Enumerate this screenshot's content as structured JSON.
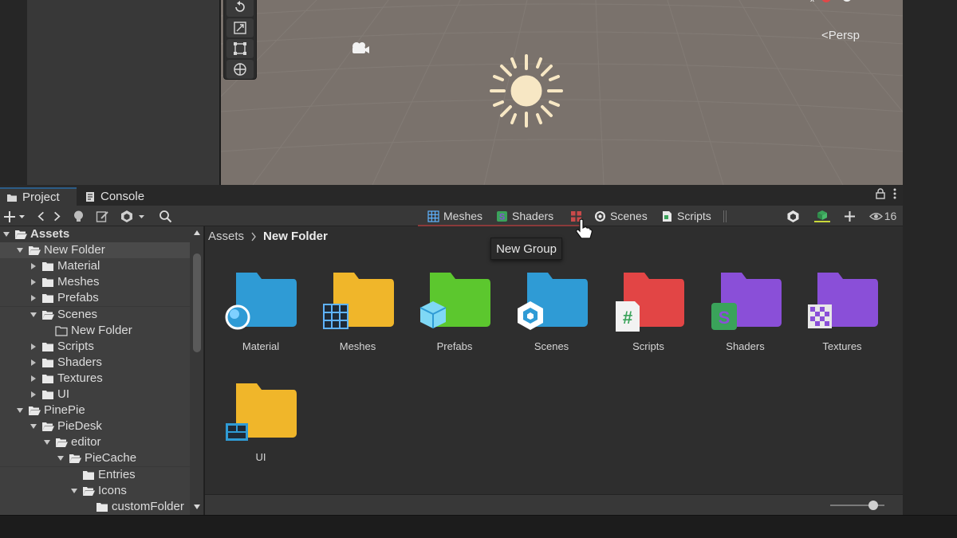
{
  "scene": {
    "persp_label": "Persp"
  },
  "tabs": [
    {
      "label": "Project",
      "icon": "folder-icon"
    },
    {
      "label": "Console",
      "icon": "console-icon"
    }
  ],
  "toolbar": {
    "hidden_count": "16"
  },
  "filters": [
    {
      "label": "Meshes",
      "icon": "grid-icon"
    },
    {
      "label": "Shaders",
      "icon": "shader-icon"
    },
    {
      "label": "",
      "icon": "group-icon"
    },
    {
      "label": "Scenes",
      "icon": "unity-icon"
    },
    {
      "label": "Scripts",
      "icon": "script-icon"
    }
  ],
  "tooltip": "New Group",
  "tree": [
    {
      "label": "Assets",
      "depth": 0,
      "expanded": true,
      "bold": true
    },
    {
      "label": "New Folder",
      "depth": 1,
      "expanded": true,
      "selected": true
    },
    {
      "label": "Material",
      "depth": 2,
      "expanded": false
    },
    {
      "label": "Meshes",
      "depth": 2,
      "expanded": false
    },
    {
      "label": "Prefabs",
      "depth": 2,
      "expanded": false
    },
    {
      "label": "Scenes",
      "depth": 2,
      "expanded": true
    },
    {
      "label": "New Folder",
      "depth": 3,
      "expanded": null
    },
    {
      "label": "Scripts",
      "depth": 2,
      "expanded": false
    },
    {
      "label": "Shaders",
      "depth": 2,
      "expanded": false
    },
    {
      "label": "Textures",
      "depth": 2,
      "expanded": false
    },
    {
      "label": "UI",
      "depth": 2,
      "expanded": false
    },
    {
      "label": "PinePie",
      "depth": 1,
      "expanded": true
    },
    {
      "label": "PieDesk",
      "depth": 2,
      "expanded": true
    },
    {
      "label": "editor",
      "depth": 3,
      "expanded": true
    },
    {
      "label": "PieCache",
      "depth": 4,
      "expanded": true
    },
    {
      "label": "Entries",
      "depth": 5,
      "expanded": null
    },
    {
      "label": "Icons",
      "depth": 5,
      "expanded": true
    },
    {
      "label": "customFolder",
      "depth": 6,
      "expanded": null
    }
  ],
  "breadcrumb": {
    "root": "Assets",
    "current": "New Folder"
  },
  "folders": [
    {
      "name": "Material",
      "color": "#2f9bd5",
      "badge": "material"
    },
    {
      "name": "Meshes",
      "color": "#f0b62a",
      "badge": "meshes"
    },
    {
      "name": "Prefabs",
      "color": "#5cc72e",
      "badge": "prefab"
    },
    {
      "name": "Scenes",
      "color": "#2f9bd5",
      "badge": "unity"
    },
    {
      "name": "Scripts",
      "color": "#e24545",
      "badge": "script"
    },
    {
      "name": "Shaders",
      "color": "#8a4fd8",
      "badge": "shader"
    },
    {
      "name": "Textures",
      "color": "#8a4fd8",
      "badge": "texture"
    },
    {
      "name": "UI",
      "color": "#f0b62a",
      "badge": "ui"
    }
  ],
  "colors": {
    "accent": "#2c5d87",
    "script_green": "#3aa35a"
  }
}
